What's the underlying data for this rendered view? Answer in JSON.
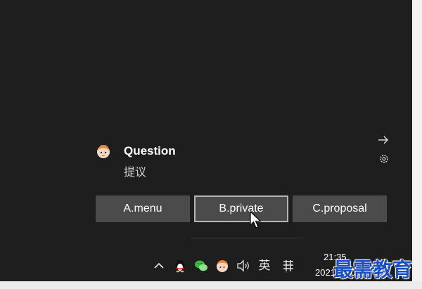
{
  "notification": {
    "title": "Question",
    "subtitle": "提议",
    "actions": [
      "A.menu",
      "B.private",
      "C.proposal"
    ]
  },
  "taskbar": {
    "input_language": "英",
    "time": "21:35",
    "date": "2021/6/10"
  },
  "watermark": "最需教育",
  "colors": {
    "background": "#1e1e1e",
    "button": "#4b4b4b",
    "watermark": "#1a4fc4"
  }
}
